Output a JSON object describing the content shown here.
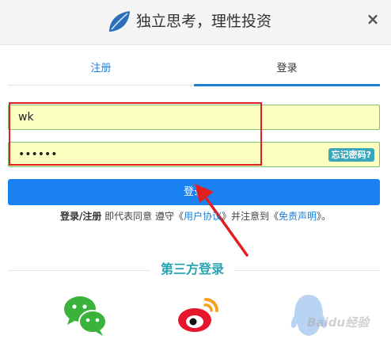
{
  "header": {
    "slogan": "独立思考，理性投资",
    "close_label": "×"
  },
  "tabs": [
    {
      "label": "注册"
    },
    {
      "label": "登录"
    }
  ],
  "form": {
    "username_value": "wk",
    "password_value": "••••••",
    "forgot_label": "忘记密码?"
  },
  "login_button_label": "登录",
  "agreement": {
    "prefix": "登录/注册",
    "text1": " 即代表同意 遵守《",
    "user_agreement": "用户协议",
    "text2": "》并注意到《",
    "disclaimer": "免责声明",
    "text3": "》。"
  },
  "third_party": {
    "title": "第三方登录"
  },
  "watermark": "Baidu经验",
  "colors": {
    "accent": "#1a82f0",
    "teal": "#2aa3b3",
    "input_bg": "#fbffc0",
    "annotation_red": "#e02020"
  }
}
